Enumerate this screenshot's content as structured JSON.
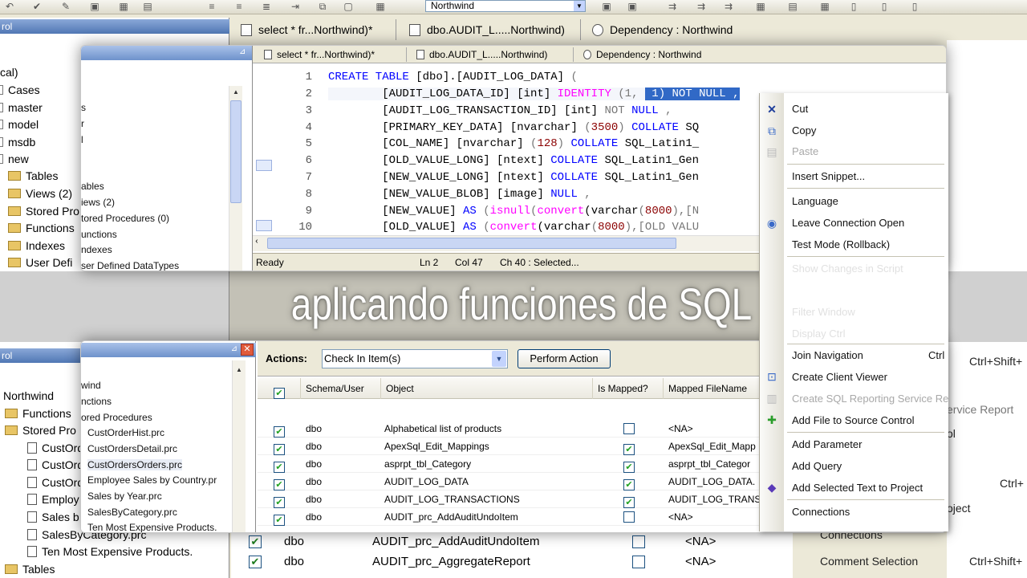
{
  "toolbar": {
    "database": "Northwind"
  },
  "background": {
    "tabs": [
      "select * fr...Northwind)*",
      "dbo.AUDIT_L.....Northwind)",
      "Dependency : Northwind"
    ],
    "left_title_top": "rol",
    "left_title_bottom": "rol",
    "tree_top": [
      "cal)",
      "Cases",
      "master",
      "model",
      "msdb",
      "new",
      "Tables",
      "Views (2)",
      "Stored Pro",
      "Functions",
      "Indexes",
      "User Defi"
    ],
    "tree_bottom": [
      "Northwind",
      "Functions",
      "Stored Pro",
      "CustOrd",
      "CustOrd",
      "CustOrd",
      "Employ",
      "Sales b",
      "SalesByCategory.prc",
      "Ten Most Expensive Products.",
      "Tables"
    ],
    "right_items": [
      "Ctrl+Shift+",
      "ervice Report",
      "ol",
      "Ctrl+",
      "oject",
      "Connections",
      "Comment Selection",
      "Ctrl+Shift+"
    ],
    "rows": [
      {
        "schema": "dbo",
        "object": "AUDIT_prc_AddAuditUndoItem",
        "file": "<NA>"
      },
      {
        "schema": "dbo",
        "object": "AUDIT_prc_AggregateReport",
        "file": "<NA>"
      }
    ]
  },
  "upper": {
    "tabs": [
      "select * fr...Northwind)*",
      "dbo.AUDIT_L.....Northwind)",
      "Dependency : Northwind"
    ],
    "tree": [
      "ables",
      "iews (2)",
      "tored Procedures (0)",
      "unctions",
      "ndexes",
      "ser Defined DataTypes"
    ],
    "tree_partial": [
      "s",
      "r",
      "l"
    ],
    "lines": [
      "1",
      "2",
      "3",
      "4",
      "5",
      "6",
      "7",
      "8",
      "9",
      "10"
    ],
    "status": {
      "ready": "Ready",
      "ln": "Ln 2",
      "col": "Col 47",
      "ch": "Ch 40 : Selected..."
    }
  },
  "caption": "aplicando funciones de SQL",
  "lower": {
    "tree": [
      "wind",
      "nctions",
      "ored Procedures",
      "CustOrderHist.prc",
      "CustOrdersDetail.prc",
      "CustOrdersOrders.prc",
      "Employee Sales by Country.pr",
      "Sales by Year.prc",
      "SalesByCategory.prc",
      "Ten Most Expensive Products."
    ],
    "actions_label": "Actions:",
    "action_selected": "Check In Item(s)",
    "perform_button": "Perform Action",
    "columns": [
      "Schema/User",
      "Object",
      "Is Mapped?",
      "Mapped FileName"
    ],
    "rows": [
      {
        "schema": "dbo",
        "object": "Alphabetical list of products",
        "mapped": false,
        "file": "<NA>"
      },
      {
        "schema": "dbo",
        "object": "ApexSql_Edit_Mappings",
        "mapped": true,
        "file": "ApexSql_Edit_Mapp"
      },
      {
        "schema": "dbo",
        "object": "asprpt_tbl_Category",
        "mapped": true,
        "file": "asprpt_tbl_Categor"
      },
      {
        "schema": "dbo",
        "object": "AUDIT_LOG_DATA",
        "mapped": true,
        "file": "AUDIT_LOG_DATA."
      },
      {
        "schema": "dbo",
        "object": "AUDIT_LOG_TRANSACTIONS",
        "mapped": true,
        "file": "AUDIT_LOG_TRANS"
      },
      {
        "schema": "dbo",
        "object": "AUDIT_prc_AddAuditUndoItem",
        "mapped": false,
        "file": "<NA>"
      }
    ]
  },
  "menu": {
    "cut": "Cut",
    "copy": "Copy",
    "paste": "Paste",
    "insert_snippet": "Insert Snippet...",
    "language": "Language",
    "leave_connection": "Leave Connection Open",
    "test_mode": "Test Mode (Rollback)",
    "show_changes": "Show Changes in Script",
    "faded1": "Filter Window",
    "faded2": "Display Ctrl",
    "join_navigation": "Join Navigation",
    "join_shortcut": "Ctrl",
    "create_client_viewer": "Create Client Viewer",
    "create_reporting": "Create SQL Reporting Service Re",
    "add_file_source": "Add File to Source Control",
    "add_parameter": "Add Parameter",
    "add_query": "Add Query",
    "add_selected_text": "Add Selected Text to Project",
    "connections": "Connections"
  }
}
